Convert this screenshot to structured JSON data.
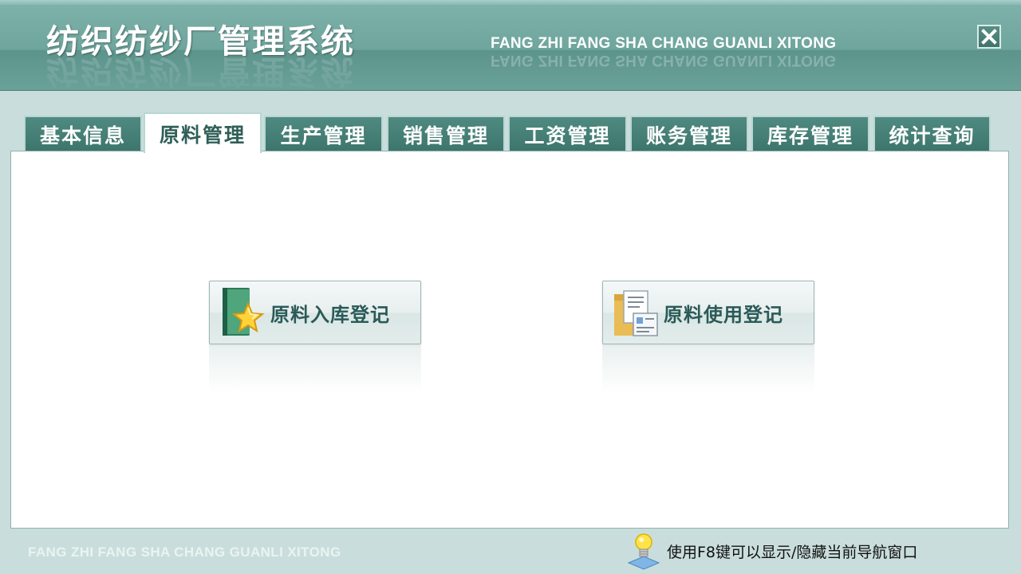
{
  "header": {
    "title": "纺织纺纱厂管理系统",
    "subtitle": "FANG ZHI FANG SHA CHANG GUANLI XITONG",
    "close_icon": "close-icon"
  },
  "tabs": [
    {
      "label": "基本信息",
      "active": false
    },
    {
      "label": "原料管理",
      "active": true
    },
    {
      "label": "生产管理",
      "active": false
    },
    {
      "label": "销售管理",
      "active": false
    },
    {
      "label": "工资管理",
      "active": false
    },
    {
      "label": "账务管理",
      "active": false
    },
    {
      "label": "库存管理",
      "active": false
    },
    {
      "label": "统计查询",
      "active": false
    }
  ],
  "actions": [
    {
      "label": "原料入库登记",
      "icon": "book-star-icon"
    },
    {
      "label": "原料使用登记",
      "icon": "folder-documents-icon"
    }
  ],
  "footer": {
    "brand": "FANG ZHI FANG SHA CHANG GUANLI XITONG",
    "hint": "使用F8键可以显示/隐藏当前导航窗口",
    "hint_icon": "lightbulb-icon"
  },
  "colors": {
    "header": "#6ea59d",
    "tab": "#3f786f",
    "background": "#c9dedc",
    "button_text": "#2a5a57"
  }
}
